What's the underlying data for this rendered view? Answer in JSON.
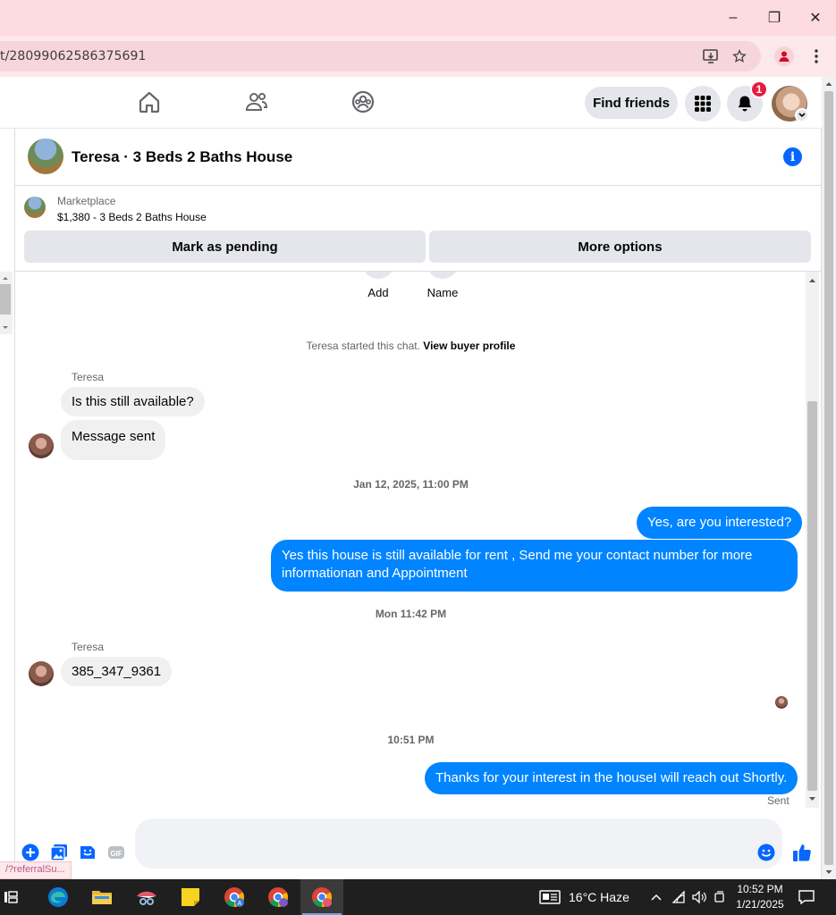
{
  "browser": {
    "url": "t/28099062586375691",
    "buttons": {
      "minimize": "–",
      "restore": "❐",
      "close": "✕"
    }
  },
  "fb_nav": {
    "find_friends": "Find friends",
    "notification_count": "1",
    "icons": [
      "home-icon",
      "friends-icon",
      "groups-icon",
      "apps-grid-icon",
      "bell-icon"
    ]
  },
  "chat": {
    "title": "Teresa · 3 Beds 2 Baths House",
    "listing": {
      "kicker": "Marketplace",
      "summary": "$1,380 - 3 Beds 2 Baths House",
      "buttons": {
        "pending": "Mark as pending",
        "more": "More options"
      }
    },
    "quick_actions": {
      "add": "Add",
      "name": "Name"
    },
    "started_text": "Teresa started this chat.",
    "started_link": "View buyer profile",
    "messages": {
      "sender1": "Teresa",
      "m1": "Is this still available?",
      "m2": "Message sent",
      "stamp1": "Jan 12, 2025, 11:00 PM",
      "m3": "Yes, are you interested?",
      "m4": "Yes this house is still available for rent , Send me your contact number for more informationan and Appointment",
      "stamp2": "Mon 11:42 PM",
      "sender2": "Teresa",
      "m5": "385_347_9361",
      "stamp3": "10:51 PM",
      "m6": "Thanks for your interest in the houseI will reach out Shortly.",
      "status": "Sent"
    }
  },
  "status_tip": "/?referralSu...",
  "taskbar": {
    "weather": "16°C  Haze",
    "time": "10:52 PM",
    "date": "1/21/2025"
  },
  "colors": {
    "accent": "#0084ff",
    "brand_blue": "#0866ff",
    "badge": "#e41e3f",
    "titlebar": "#fddbe1"
  }
}
